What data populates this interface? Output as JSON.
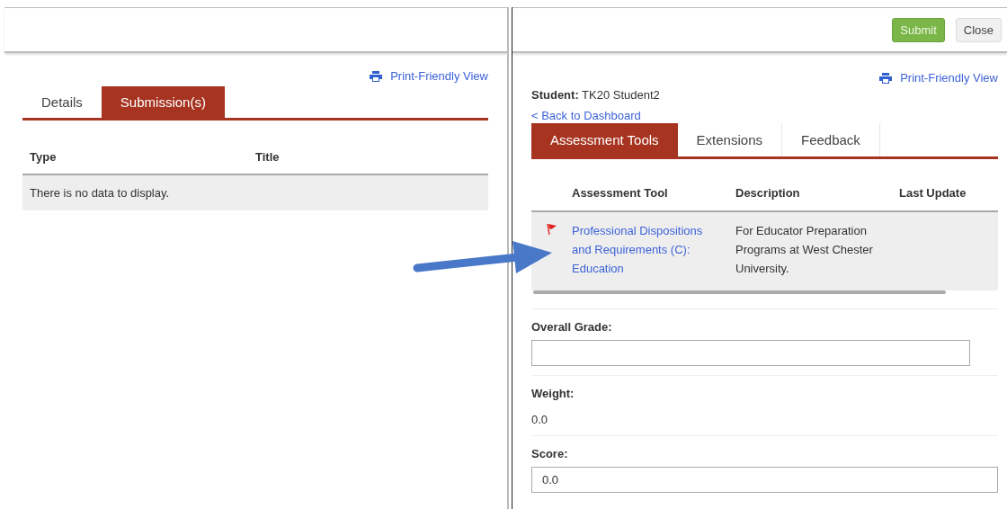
{
  "left_pane": {
    "print_link": "Print-Friendly View",
    "tabs": [
      {
        "label": "Details",
        "selected": false
      },
      {
        "label": "Submission(s)",
        "selected": true
      }
    ],
    "table": {
      "columns": [
        "Type",
        "Title"
      ],
      "empty_message": "There is no data to display."
    }
  },
  "right_pane": {
    "buttons": [
      {
        "label": "Submit",
        "kind": "primary"
      },
      {
        "label": "Close",
        "kind": "default"
      }
    ],
    "print_link": "Print-Friendly View",
    "student": {
      "label": "Student:",
      "value": "TK20 Student2"
    },
    "back_link": "< Back to Dashboard",
    "tabs": [
      {
        "label": "Assessment Tools",
        "selected": true
      },
      {
        "label": "Extensions",
        "selected": false
      },
      {
        "label": "Feedback",
        "selected": false
      }
    ],
    "table": {
      "columns": [
        "Assessment Tool",
        "Description",
        "Last Update"
      ],
      "rows": [
        {
          "flagged": true,
          "tool": "Professional Dispositions and Requirements (C): Education",
          "description": "For Educator Preparation Programs at West Chester University."
        }
      ]
    },
    "fields": [
      {
        "kind": "input",
        "label": "Overall Grade:"
      },
      {
        "kind": "text",
        "label": "Weight:",
        "value": "0.0"
      },
      {
        "kind": "input",
        "label": "Score:",
        "value": "0.0"
      }
    ]
  }
}
